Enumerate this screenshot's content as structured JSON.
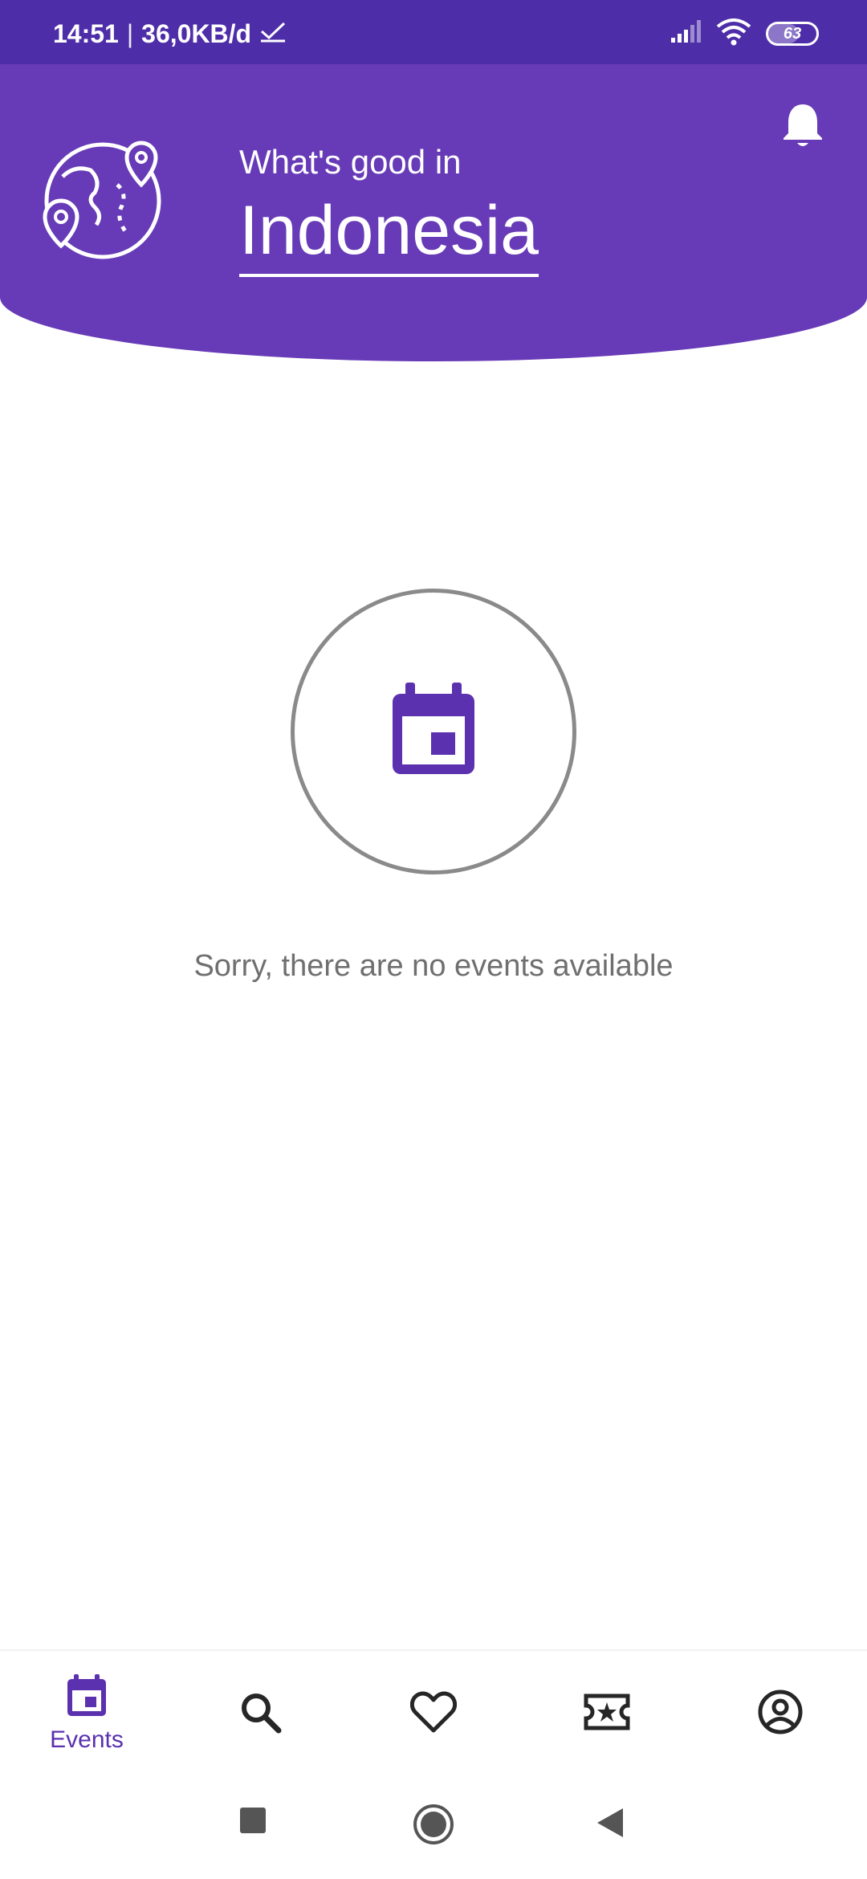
{
  "status_bar": {
    "time": "14:51",
    "separator": "|",
    "network_speed": "36,0KB/d",
    "battery_level": "63",
    "icons": [
      "check-icon",
      "signal-icon",
      "wifi-icon",
      "battery-icon"
    ]
  },
  "header": {
    "subtitle": "What's good in",
    "location": "Indonesia",
    "icons": [
      "globe-location-icon",
      "bell-icon"
    ]
  },
  "empty_state": {
    "icon": "calendar-icon",
    "message": "Sorry, there are no events available"
  },
  "bottom_nav": {
    "items": [
      {
        "icon": "calendar-icon",
        "label": "Events",
        "active": true
      },
      {
        "icon": "search-icon",
        "label": ""
      },
      {
        "icon": "heart-icon",
        "label": ""
      },
      {
        "icon": "ticket-icon",
        "label": ""
      },
      {
        "icon": "account-icon",
        "label": ""
      }
    ]
  },
  "system_nav": {
    "icons": [
      "recent-apps-icon",
      "home-icon",
      "back-icon"
    ]
  },
  "colors": {
    "status_bar": "#4e2da9",
    "header": "#673ab7",
    "accent": "#5b31b0",
    "muted_text": "#6f6f6f"
  }
}
